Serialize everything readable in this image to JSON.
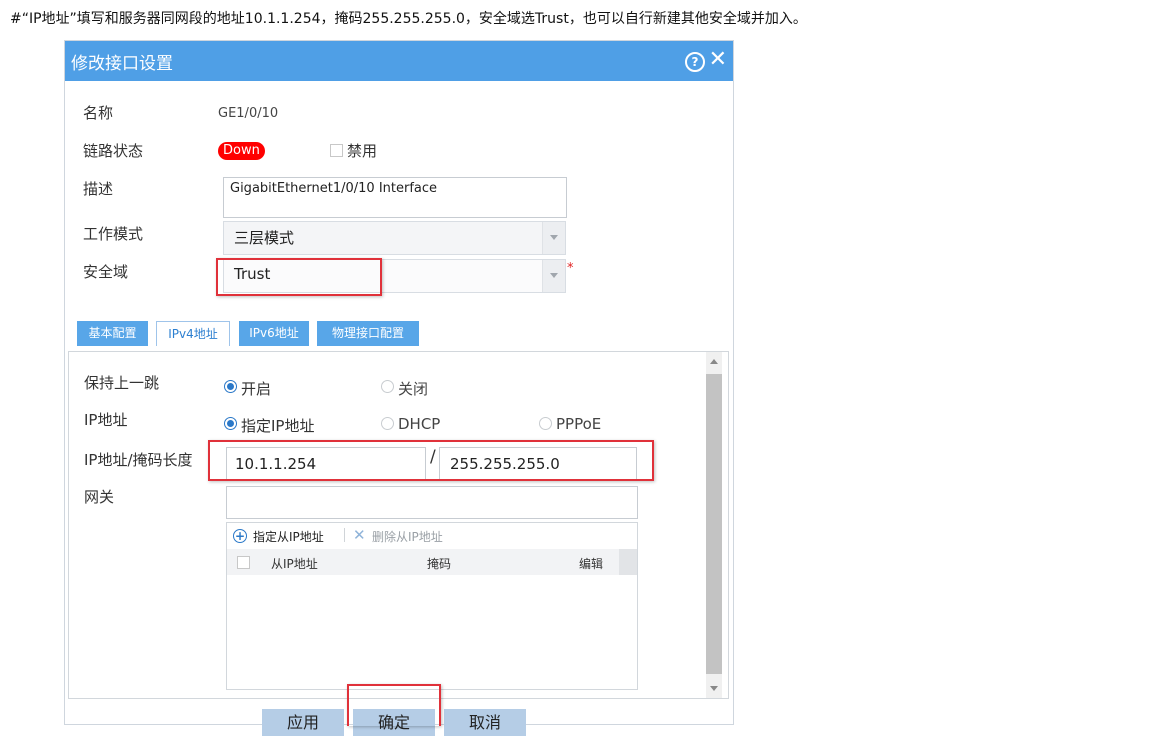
{
  "caption": "#“IP地址”填写和服务器同网段的地址10.1.1.254，掩码255.255.255.0，安全域选Trust，也可以自行新建其他安全域并加入。",
  "dialog": {
    "title": "修改接口设置",
    "help_symbol": "?",
    "close_symbol": "✕",
    "fields": {
      "name_label": "名称",
      "name_value": "GE1/0/10",
      "link_label": "链路状态",
      "link_value": "Down",
      "disable_label": "禁用",
      "desc_label": "描述",
      "desc_value": "GigabitEthernet1/0/10 Interface",
      "mode_label": "工作模式",
      "mode_value": "三层模式",
      "zone_label": "安全域",
      "zone_value": "Trust",
      "required_mark": "*"
    },
    "tabs": [
      {
        "label": "基本配置"
      },
      {
        "label": "IPv4地址"
      },
      {
        "label": "IPv6地址"
      },
      {
        "label": "物理接口配置"
      }
    ],
    "ipv4": {
      "hop_label": "保持上一跳",
      "hop_on": "开启",
      "hop_off": "关闭",
      "ip_label": "IP地址",
      "ip_opt_static": "指定IP地址",
      "ip_opt_dhcp": "DHCP",
      "ip_opt_pppoe": "PPPoE",
      "ipmask_label": "IP地址/掩码长度",
      "ip_value": "10.1.1.254",
      "slash": "/",
      "mask_value": "255.255.255.0",
      "gateway_label": "网关",
      "gateway_value": "",
      "add_secondary": "指定从IP地址",
      "del_secondary": "删除从IP地址",
      "col_secondary_ip": "从IP地址",
      "col_mask": "掩码",
      "col_edit": "编辑"
    },
    "buttons": {
      "apply": "应用",
      "ok": "确定",
      "cancel": "取消"
    }
  }
}
